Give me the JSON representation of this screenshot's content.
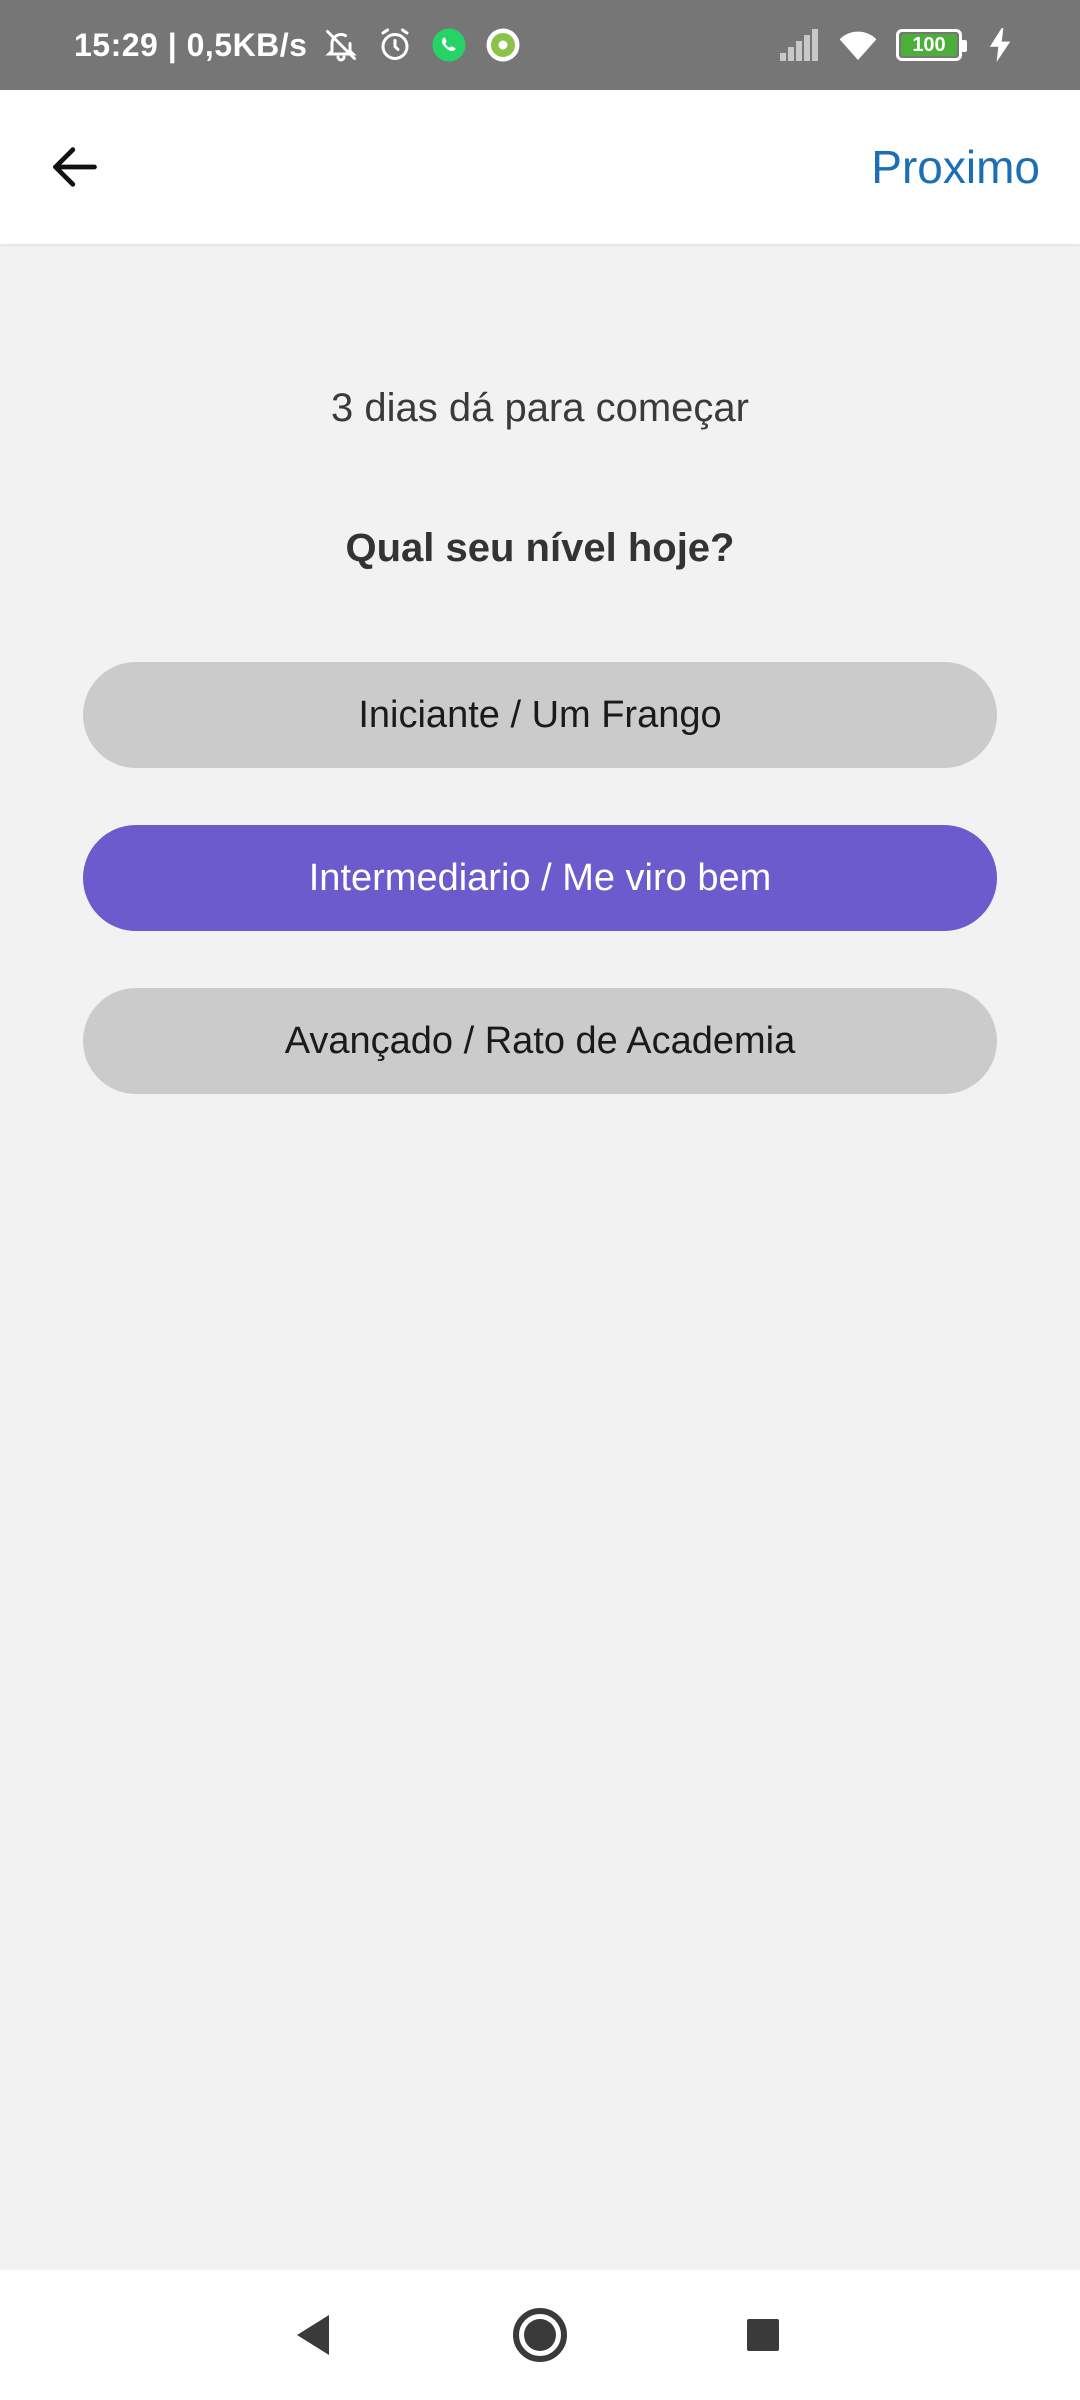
{
  "status_bar": {
    "time": "15:29 | 0,5KB/s",
    "battery_level": "100",
    "icons": [
      "bell-off-icon",
      "alarm-icon",
      "whatsapp-icon",
      "settings-badge-icon",
      "signal-icon",
      "wifi-icon",
      "battery-icon",
      "charging-icon"
    ]
  },
  "app_bar": {
    "back_icon": "arrow-left-icon",
    "next_label": "Proximo"
  },
  "content": {
    "subtitle": "3 dias dá para começar",
    "question": "Qual seu nível hoje?",
    "options": [
      {
        "label": "Iniciante / Um Frango",
        "selected": false
      },
      {
        "label": "Intermediario / Me viro bem",
        "selected": true
      },
      {
        "label": "Avançado / Rato de Academia",
        "selected": false
      }
    ]
  },
  "colors": {
    "status_bar": "#767676",
    "accent_link": "#1b6fb5",
    "selected_option": "#6b5bcd",
    "unselected_option": "#cbcbcb",
    "background": "#f2f2f2",
    "whatsapp_green": "#25d366"
  },
  "nav_bar": {
    "icons": [
      "nav-back-icon",
      "nav-home-icon",
      "nav-recents-icon"
    ]
  }
}
